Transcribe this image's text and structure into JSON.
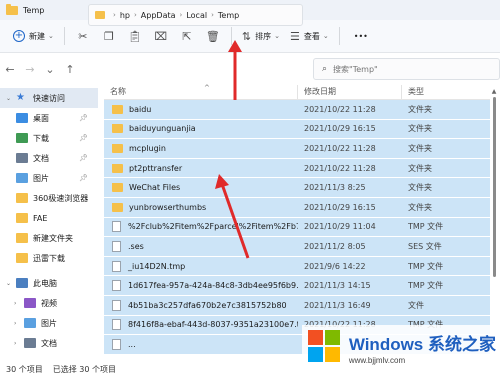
{
  "window": {
    "title": "Temp"
  },
  "toolbar": {
    "new_label": "新建",
    "sort_label": "排序",
    "view_label": "查看",
    "more_label": "•••"
  },
  "address": {
    "crumbs": [
      "hp",
      "AppData",
      "Local",
      "Temp"
    ]
  },
  "search": {
    "placeholder": "搜索\"Temp\""
  },
  "sidebar": {
    "items": [
      {
        "label": "快速访问",
        "icon": "star-icon"
      },
      {
        "label": "桌面",
        "icon": "desktop-icon"
      },
      {
        "label": "下载",
        "icon": "download-icon"
      },
      {
        "label": "文档",
        "icon": "document-icon"
      },
      {
        "label": "图片",
        "icon": "picture-icon"
      },
      {
        "label": "360极速浏览器",
        "icon": "folder-icon"
      },
      {
        "label": "FAE",
        "icon": "folder-icon"
      },
      {
        "label": "新建文件夹",
        "icon": "folder-icon"
      },
      {
        "label": "迅雷下载",
        "icon": "folder-icon"
      },
      {
        "label": "此电脑",
        "icon": "pc-icon"
      },
      {
        "label": "视频",
        "icon": "video-icon"
      },
      {
        "label": "图片",
        "icon": "picture-icon"
      },
      {
        "label": "文档",
        "icon": "document-icon"
      }
    ]
  },
  "columns": {
    "name": "名称",
    "date": "修改日期",
    "type": "类型"
  },
  "rows": [
    {
      "name": "baidu",
      "date": "2021/10/22 11:28",
      "type": "文件夹",
      "kind": "folder"
    },
    {
      "name": "baiduyunguanjia",
      "date": "2021/10/29 16:15",
      "type": "文件夹",
      "kind": "folder"
    },
    {
      "name": "mcplugin",
      "date": "2021/10/22 11:28",
      "type": "文件夹",
      "kind": "folder"
    },
    {
      "name": "pt2pttransfer",
      "date": "2021/10/22 11:28",
      "type": "文件夹",
      "kind": "folder"
    },
    {
      "name": "WeChat Files",
      "date": "2021/11/3 8:25",
      "type": "文件夹",
      "kind": "folder"
    },
    {
      "name": "yunbrowserthumbs",
      "date": "2021/10/29 16:15",
      "type": "文件夹",
      "kind": "folder"
    },
    {
      "name": "%2Fclub%2Fitem%2Fparcel%2Fitem%2Fb7...",
      "date": "2021/10/29 11:04",
      "type": "TMP 文件",
      "kind": "file"
    },
    {
      "name": ".ses",
      "date": "2021/11/2 8:05",
      "type": "SES 文件",
      "kind": "file"
    },
    {
      "name": "_iu14D2N.tmp",
      "date": "2021/9/6 14:22",
      "type": "TMP 文件",
      "kind": "file"
    },
    {
      "name": "1d617fea-957a-424a-84c8-3db4ee95f6b9...",
      "date": "2021/11/3 14:15",
      "type": "TMP 文件",
      "kind": "file"
    },
    {
      "name": "4b51ba3c257dfa670b2e7c3815752b80",
      "date": "2021/11/3 16:49",
      "type": "文件",
      "kind": "file"
    },
    {
      "name": "8f416f8a-ebaf-443d-8037-9351a23100e7.t...",
      "date": "2021/10/22 11:28",
      "type": "TMP 文件",
      "kind": "file"
    },
    {
      "name": "...",
      "date": "",
      "type": "",
      "kind": "file"
    }
  ],
  "status": {
    "count": "30 个项目",
    "selected": "已选择 30 个项目"
  },
  "watermark": {
    "main": "Windows 系统之家",
    "sub": "www.bjjmlv.com"
  },
  "colors": {
    "selection": "#cce4f7",
    "accent": "#1e66c8",
    "annotation_arrow": "#e02a2a",
    "folder": "#f5c04a"
  }
}
